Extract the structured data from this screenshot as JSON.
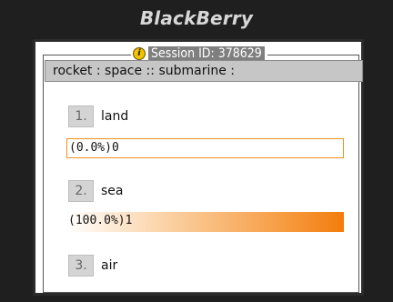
{
  "device": {
    "brand": "BlackBerry"
  },
  "session": {
    "icon": "info-icon",
    "label": "Session ID: 378629"
  },
  "question": {
    "text": "rocket : space :: submarine :"
  },
  "options": [
    {
      "number": "1.",
      "label": "land",
      "result_text": "(0.0%)0",
      "percent": 0.0
    },
    {
      "number": "2.",
      "label": "sea",
      "result_text": "(100.0%)1",
      "percent": 100.0
    },
    {
      "number": "3.",
      "label": "air"
    }
  ],
  "colors": {
    "bar_accent": "#f27d0c",
    "bar_border": "#f0911e",
    "question_bg": "#c6c6c6"
  }
}
